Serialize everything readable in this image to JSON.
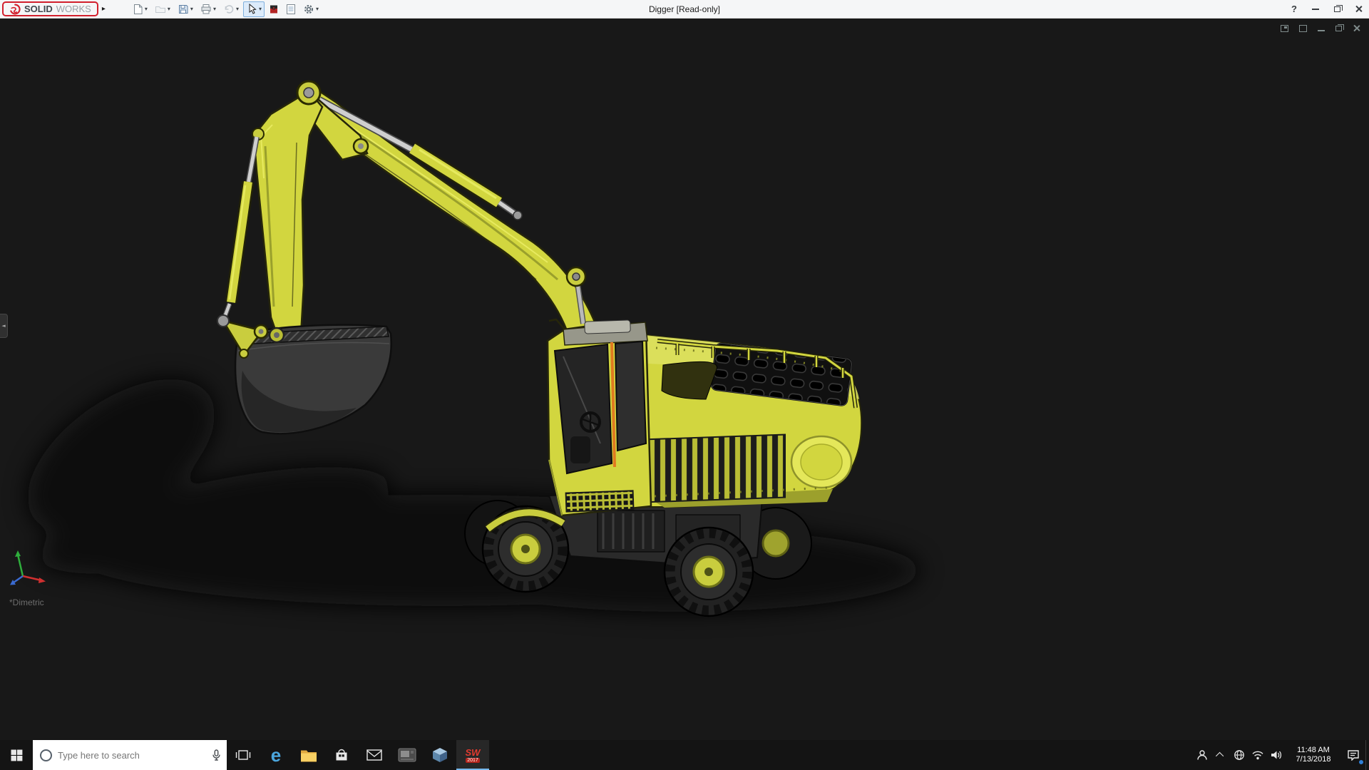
{
  "app": {
    "name_bold": "SOLID",
    "name_light": "WORKS",
    "document_title": "Digger [Read-only]"
  },
  "glyphs": {
    "flyout_arrow": "▸",
    "caret_down": "▾",
    "help": "?",
    "panel_collapse": "◄"
  },
  "toolbar": {
    "buttons": [
      {
        "name": "new-document"
      },
      {
        "name": "open"
      },
      {
        "name": "save"
      },
      {
        "name": "print"
      },
      {
        "name": "undo"
      },
      {
        "name": "select",
        "state": "active"
      },
      {
        "name": "toolbox"
      },
      {
        "name": "document-properties"
      },
      {
        "name": "options"
      }
    ]
  },
  "viewport": {
    "orientation_label": "*Dimetric"
  },
  "taskbar": {
    "search_placeholder": "Type here to search",
    "edge_glyph": "e",
    "solidworks_badge_top": "SW",
    "solidworks_badge_year": "2017",
    "clock_time": "11:48 AM",
    "clock_date": "7/13/2018"
  },
  "colors": {
    "digger_yellow": "#d2d63f",
    "viewport_background": "#181818",
    "logo_red": "#d21f2c",
    "titlebar_background": "#f5f6f7",
    "taskbar_background": "#141414"
  }
}
